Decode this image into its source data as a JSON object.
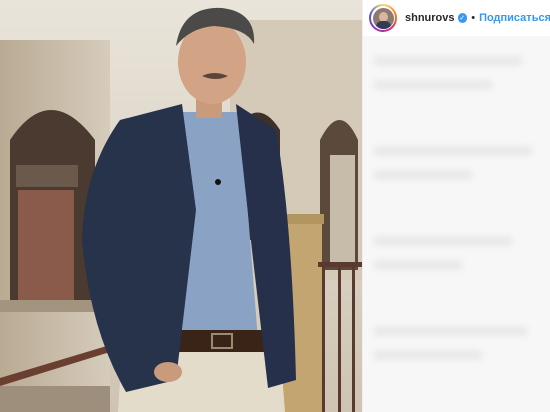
{
  "post": {
    "author": {
      "username": "shnurovs",
      "verified": true,
      "avatar_icon": "avatar-photo"
    },
    "follow_label": "Подписаться",
    "separator": "•"
  },
  "colors": {
    "link_blue": "#3897f0",
    "username_text": "#262626",
    "panel_bg": "#ffffff",
    "blur_bg": "#f7f7f7"
  }
}
